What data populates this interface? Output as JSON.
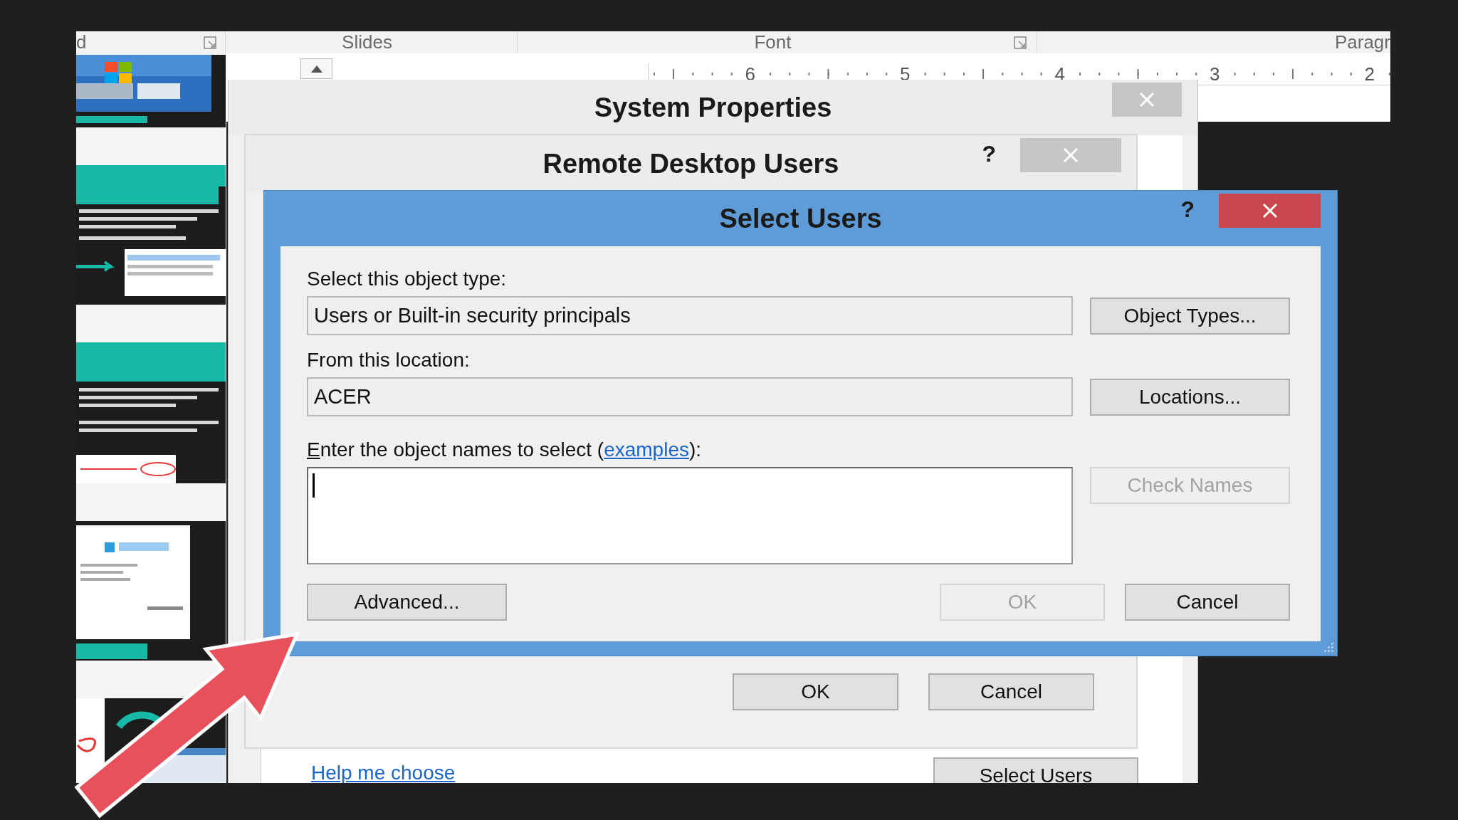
{
  "ribbon": {
    "groups": [
      {
        "label": "d",
        "launcher": true
      },
      {
        "label": "Slides",
        "launcher": false
      },
      {
        "label": "Font",
        "launcher": true
      },
      {
        "label": "Paragr",
        "launcher": false
      }
    ]
  },
  "ruler": {
    "numbers": [
      "6",
      "5",
      "4",
      "3",
      "2"
    ]
  },
  "system_properties": {
    "title": "System Properties",
    "active": false,
    "link": "Help me choose",
    "button": "Select Users"
  },
  "remote_desktop_users": {
    "title": "Remote Desktop Users",
    "help": "?",
    "active": false,
    "buttons": [
      {
        "label": "OK",
        "disabled": false
      },
      {
        "label": "Cancel",
        "disabled": false
      }
    ]
  },
  "select_users": {
    "title": "Select Users",
    "help": "?",
    "active": true,
    "object_type": {
      "label": "Select this object type:",
      "value": "Users or Built-in security principals",
      "button": "Object Types..."
    },
    "location": {
      "label": "From this location:",
      "value": "ACER",
      "button": "Locations..."
    },
    "names": {
      "accel": "E",
      "label_start": "nter the object names to select (",
      "link": "examples",
      "label_end": "):",
      "focused": true,
      "button": {
        "label": "Check Names",
        "disabled": true
      }
    },
    "buttons": [
      {
        "label": "Advanced...",
        "disabled": false
      },
      {
        "label": "OK",
        "disabled": true
      },
      {
        "label": "Cancel",
        "disabled": false
      }
    ]
  }
}
